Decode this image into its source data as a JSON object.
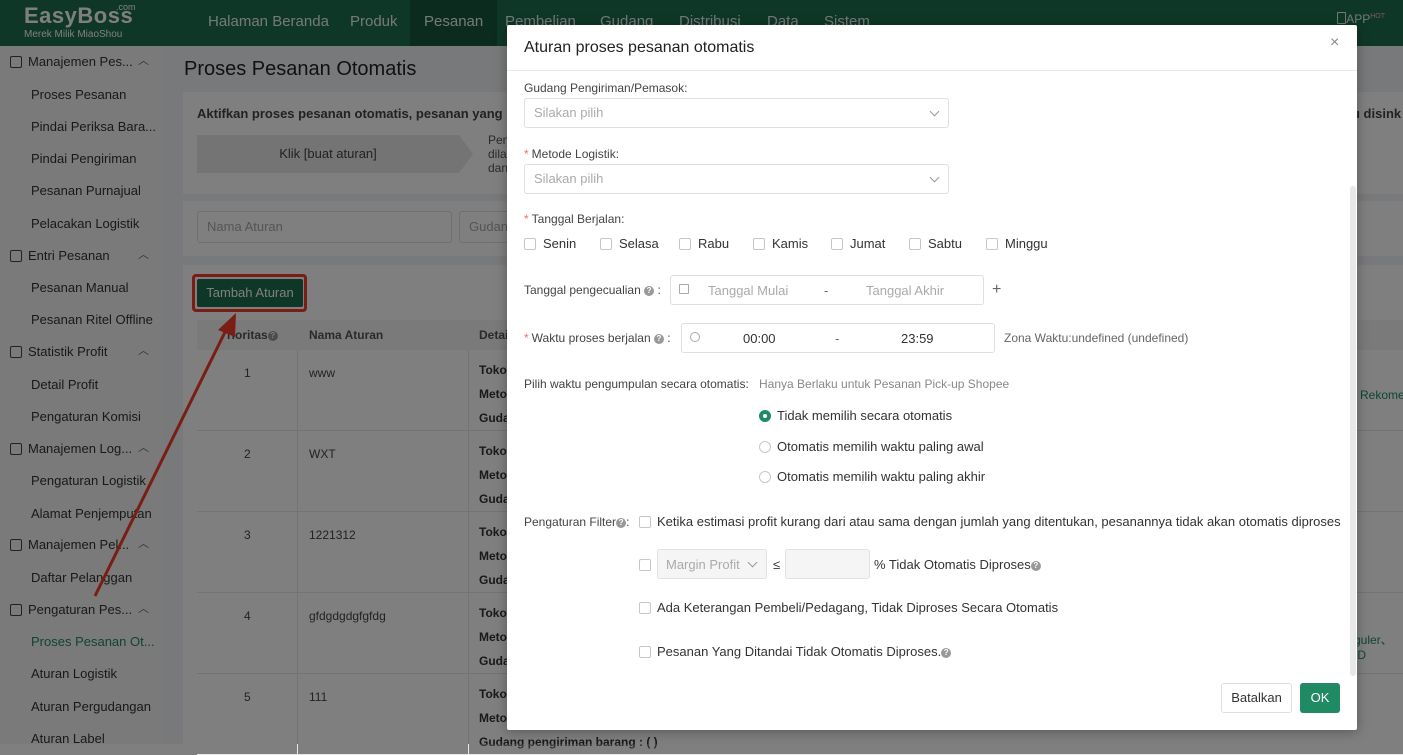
{
  "brand": {
    "name": "EasyBoss",
    "com": ".com",
    "subtitle": "Merek Milik MiaoShou"
  },
  "nav": {
    "items": [
      "Halaman Beranda",
      "Produk",
      "Pesanan",
      "Pembelian",
      "Gudang",
      "Distribusi",
      "Data",
      "Sistem"
    ],
    "active": "Pesanan",
    "app_label": "APP",
    "app_badge": "HOT"
  },
  "sidebar": {
    "groups": [
      {
        "label": "Manajemen Pes...",
        "items": [
          "Proses Pesanan",
          "Pindai Periksa Bara...",
          "Pindai Pengiriman",
          "Pesanan Purnajual",
          "Pelacakan Logistik"
        ]
      },
      {
        "label": "Entri Pesanan",
        "items": [
          "Pesanan Manual",
          "Pesanan Ritel Offline"
        ]
      },
      {
        "label": "Statistik Profit",
        "items": [
          "Detail Profit",
          "Pengaturan Komisi"
        ]
      },
      {
        "label": "Manajemen Log...",
        "items": [
          "Pengaturan Logistik",
          "Alamat Penjemputan"
        ]
      },
      {
        "label": "Manajemen Pel...",
        "items": [
          "Daftar Pelanggan"
        ]
      },
      {
        "label": "Pengaturan Pes...",
        "items": [
          "Proses Pesanan Ot...",
          "Aturan Logistik",
          "Aturan Pergudangan",
          "Aturan Label"
        ]
      }
    ],
    "active_item": "Proses Pesanan Ot..."
  },
  "page": {
    "title": "Proses Pesanan Otomatis",
    "tip": "Aktifkan proses pesanan otomatis, pesanan yang m",
    "tip_right": "u disink",
    "step1": "Klik [buat aturan]",
    "step2_lines": [
      "Pem",
      "dila",
      "dan"
    ],
    "filter_name_placeholder": "Nama Aturan",
    "filter_warehouse_placeholder": "Gudan",
    "add_button": "Tambah Aturan",
    "table": {
      "headers": [
        "rioritas",
        "Nama Aturan",
        "Detai"
      ],
      "rows": [
        {
          "no": "1",
          "name": "www",
          "lines": [
            "Toko",
            "Meto",
            "Guda"
          ]
        },
        {
          "no": "2",
          "name": "WXT",
          "lines": [
            "Toko",
            "Meto",
            "Guda"
          ]
        },
        {
          "no": "3",
          "name": "1221312",
          "lines": [
            "Toko",
            "Meto",
            "Guda"
          ]
        },
        {
          "no": "4",
          "name": "gfdgdgdgfgfdg",
          "lines": [
            "Toko",
            "Meto",
            "Guda"
          ]
        },
        {
          "no": "5",
          "name": "111",
          "lines": [
            "Toko",
            "Meto",
            "Gudang pengiriman barang : ( )"
          ]
        }
      ],
      "right_texts": [
        "Rekome",
        "guler、ID"
      ]
    }
  },
  "modal": {
    "title": "Aturan proses pesanan otomatis",
    "close": "×",
    "warehouse_label": "Gudang Pengiriman/Pemasok:",
    "warehouse_placeholder": "Silakan pilih",
    "logistics_label": "Metode Logistik:",
    "logistics_placeholder": "Silakan pilih",
    "days_label": "Tanggal Berjalan:",
    "days": [
      "Senin",
      "Selasa",
      "Rabu",
      "Kamis",
      "Jumat",
      "Sabtu",
      "Minggu"
    ],
    "exception_label": "Tanggal pengecualian",
    "exception_start": "Tanggal Mulai",
    "exception_end": "Tanggal Akhir",
    "range_sep": "-",
    "add_icon": "+",
    "time_label": "Waktu proses berjalan",
    "time_start": "00:00",
    "time_end": "23:59",
    "timezone": "Zona Waktu:undefined  (undefined)",
    "pickup_label": "Pilih waktu pengumpulan secara otomatis:",
    "pickup_note": "Hanya Berlaku untuk Pesanan Pick-up Shopee",
    "pickup_options": [
      "Tidak memilih secara otomatis",
      "Otomatis memilih waktu paling awal",
      "Otomatis memilih waktu paling akhir"
    ],
    "pickup_selected": 0,
    "filter_label": "Pengaturan Filter",
    "filter_options": {
      "profit_estimate": "Ketika estimasi profit kurang dari atau sama dengan jumlah yang ditentukan, pesanannya tidak akan otomatis diproses",
      "margin_select": "Margin Profit",
      "leq": "≤",
      "margin_suffix": "% Tidak Otomatis Diproses",
      "remark": "Ada Keterangan Pembeli/Pedagang, Tidak Diproses Secara Otomatis",
      "flagged": "Pesanan Yang Ditandai Tidak Otomatis Diproses."
    },
    "cancel": "Batalkan",
    "ok": "OK"
  },
  "colors": {
    "brand": "#1f6e4f",
    "accent": "#1f8a63",
    "highlight": "#f23a2a"
  }
}
